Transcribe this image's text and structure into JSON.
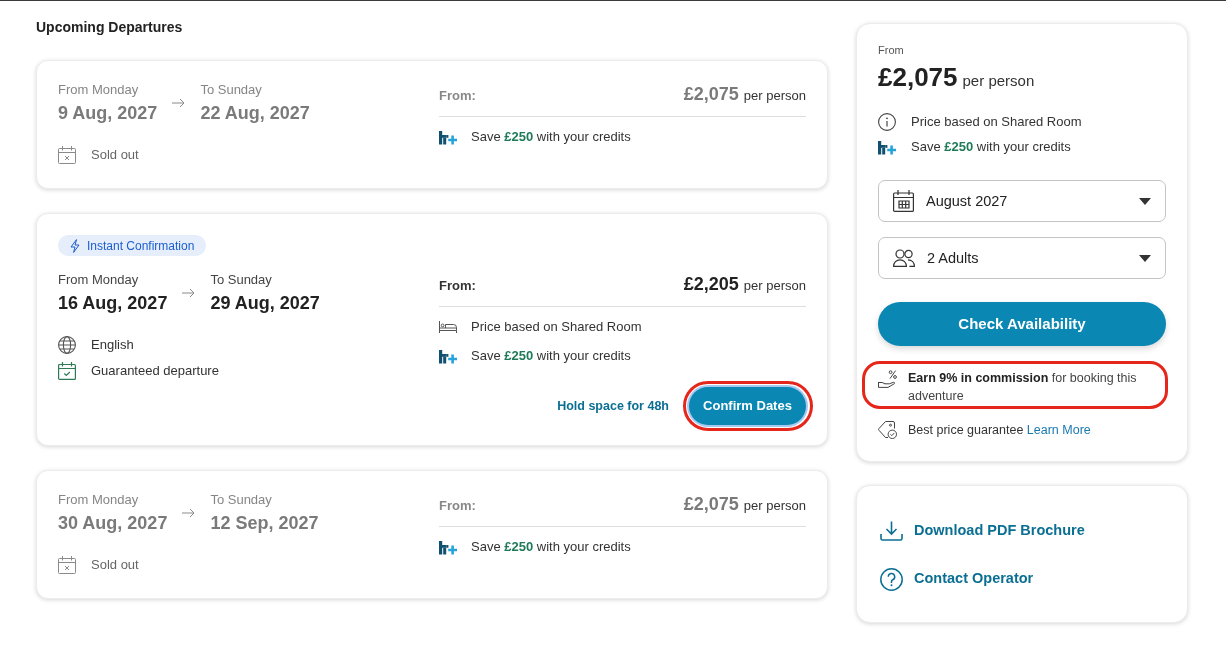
{
  "heading": "Upcoming Departures",
  "departures": [
    {
      "sold_out": true,
      "start_label": "From Monday",
      "start_date": "9 Aug, 2027",
      "end_label": "To Sunday",
      "end_date": "22 Aug, 2027",
      "details": [
        {
          "kind": "sold_out",
          "text": "Sold out"
        }
      ],
      "price_label": "From:",
      "price": "£2,075",
      "price_unit": "per person",
      "perks": [
        {
          "kind": "credits",
          "text": "Save **£250** with your credits"
        }
      ]
    },
    {
      "sold_out": false,
      "badge": "Instant Confirmation",
      "start_label": "From Monday",
      "start_date": "16 Aug, 2027",
      "end_label": "To Sunday",
      "end_date": "29 Aug, 2027",
      "details": [
        {
          "kind": "language",
          "text": "English"
        },
        {
          "kind": "guaranteed",
          "text": "Guaranteed departure"
        }
      ],
      "price_label": "From:",
      "price": "£2,205",
      "price_unit": "per person",
      "perks": [
        {
          "kind": "room",
          "text": "Price based on Shared Room"
        },
        {
          "kind": "credits",
          "text": "Save **£250** with your credits"
        }
      ],
      "hold_link": "Hold space for 48h",
      "confirm_button": {
        "label": "Confirm Dates",
        "highlighted": true
      }
    },
    {
      "sold_out": true,
      "start_label": "From Monday",
      "start_date": "30 Aug, 2027",
      "end_label": "To Sunday",
      "end_date": "12 Sep, 2027",
      "details": [
        {
          "kind": "sold_out",
          "text": "Sold out"
        }
      ],
      "price_label": "From:",
      "price": "£2,075",
      "price_unit": "per person",
      "perks": [
        {
          "kind": "credits",
          "text": "Save **£250** with your credits"
        }
      ]
    }
  ],
  "booking_panel": {
    "from_label": "From",
    "price": "£2,075",
    "price_unit": "per person",
    "notes": [
      {
        "kind": "info",
        "text": "Price based on Shared Room"
      },
      {
        "kind": "credits",
        "text": "Save **£250** with your credits"
      }
    ],
    "selects": [
      {
        "kind": "date",
        "value": "August 2027"
      },
      {
        "kind": "travellers",
        "value": "2 Adults"
      }
    ],
    "check_button": "Check Availability",
    "commission": {
      "text": "**Earn 9% in commission** for booking this adventure",
      "highlighted": true
    },
    "guarantee": {
      "text": "Best price guarantee",
      "link": "Learn More"
    }
  },
  "links_panel": {
    "links": [
      {
        "kind": "download",
        "label": "Download PDF Brochure"
      },
      {
        "kind": "help",
        "label": "Contact Operator"
      }
    ]
  }
}
